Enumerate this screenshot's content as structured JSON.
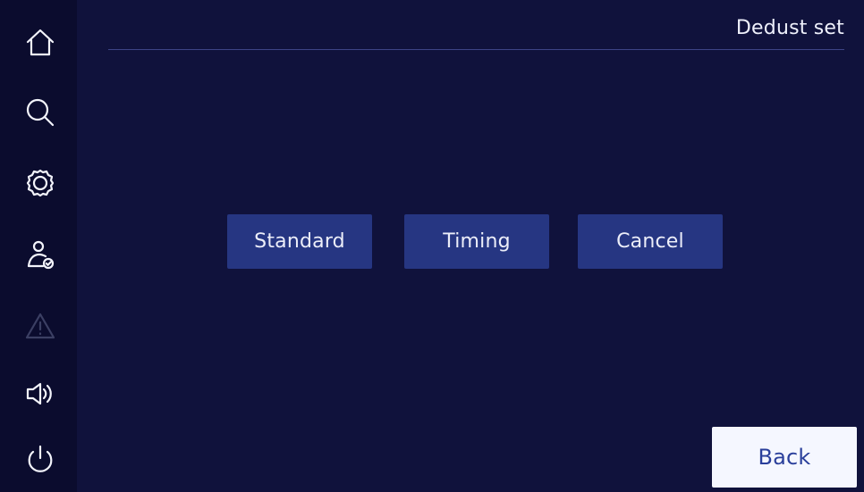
{
  "screen": {
    "title": "Dedust set"
  },
  "sidebar": {
    "items": [
      {
        "name": "home",
        "icon": "home-icon",
        "enabled": true
      },
      {
        "name": "search",
        "icon": "search-icon",
        "enabled": true
      },
      {
        "name": "settings",
        "icon": "gear-icon",
        "enabled": true
      },
      {
        "name": "user",
        "icon": "user-check-icon",
        "enabled": true
      },
      {
        "name": "warning",
        "icon": "warning-icon",
        "enabled": false
      },
      {
        "name": "sound",
        "icon": "speaker-icon",
        "enabled": true
      },
      {
        "name": "power",
        "icon": "power-icon",
        "enabled": true
      }
    ]
  },
  "actions": {
    "standard_label": "Standard",
    "timing_label": "Timing",
    "cancel_label": "Cancel"
  },
  "footer": {
    "back_label": "Back"
  },
  "colors": {
    "background": "#10123c",
    "sidebar": "#0b0c2e",
    "button": "#263682",
    "button_text": "#eceef9",
    "back_button": "#f5f7ff",
    "back_text": "#2a3f9b",
    "icon": "#f3f4fb",
    "disabled_icon": "#3b3f63"
  }
}
